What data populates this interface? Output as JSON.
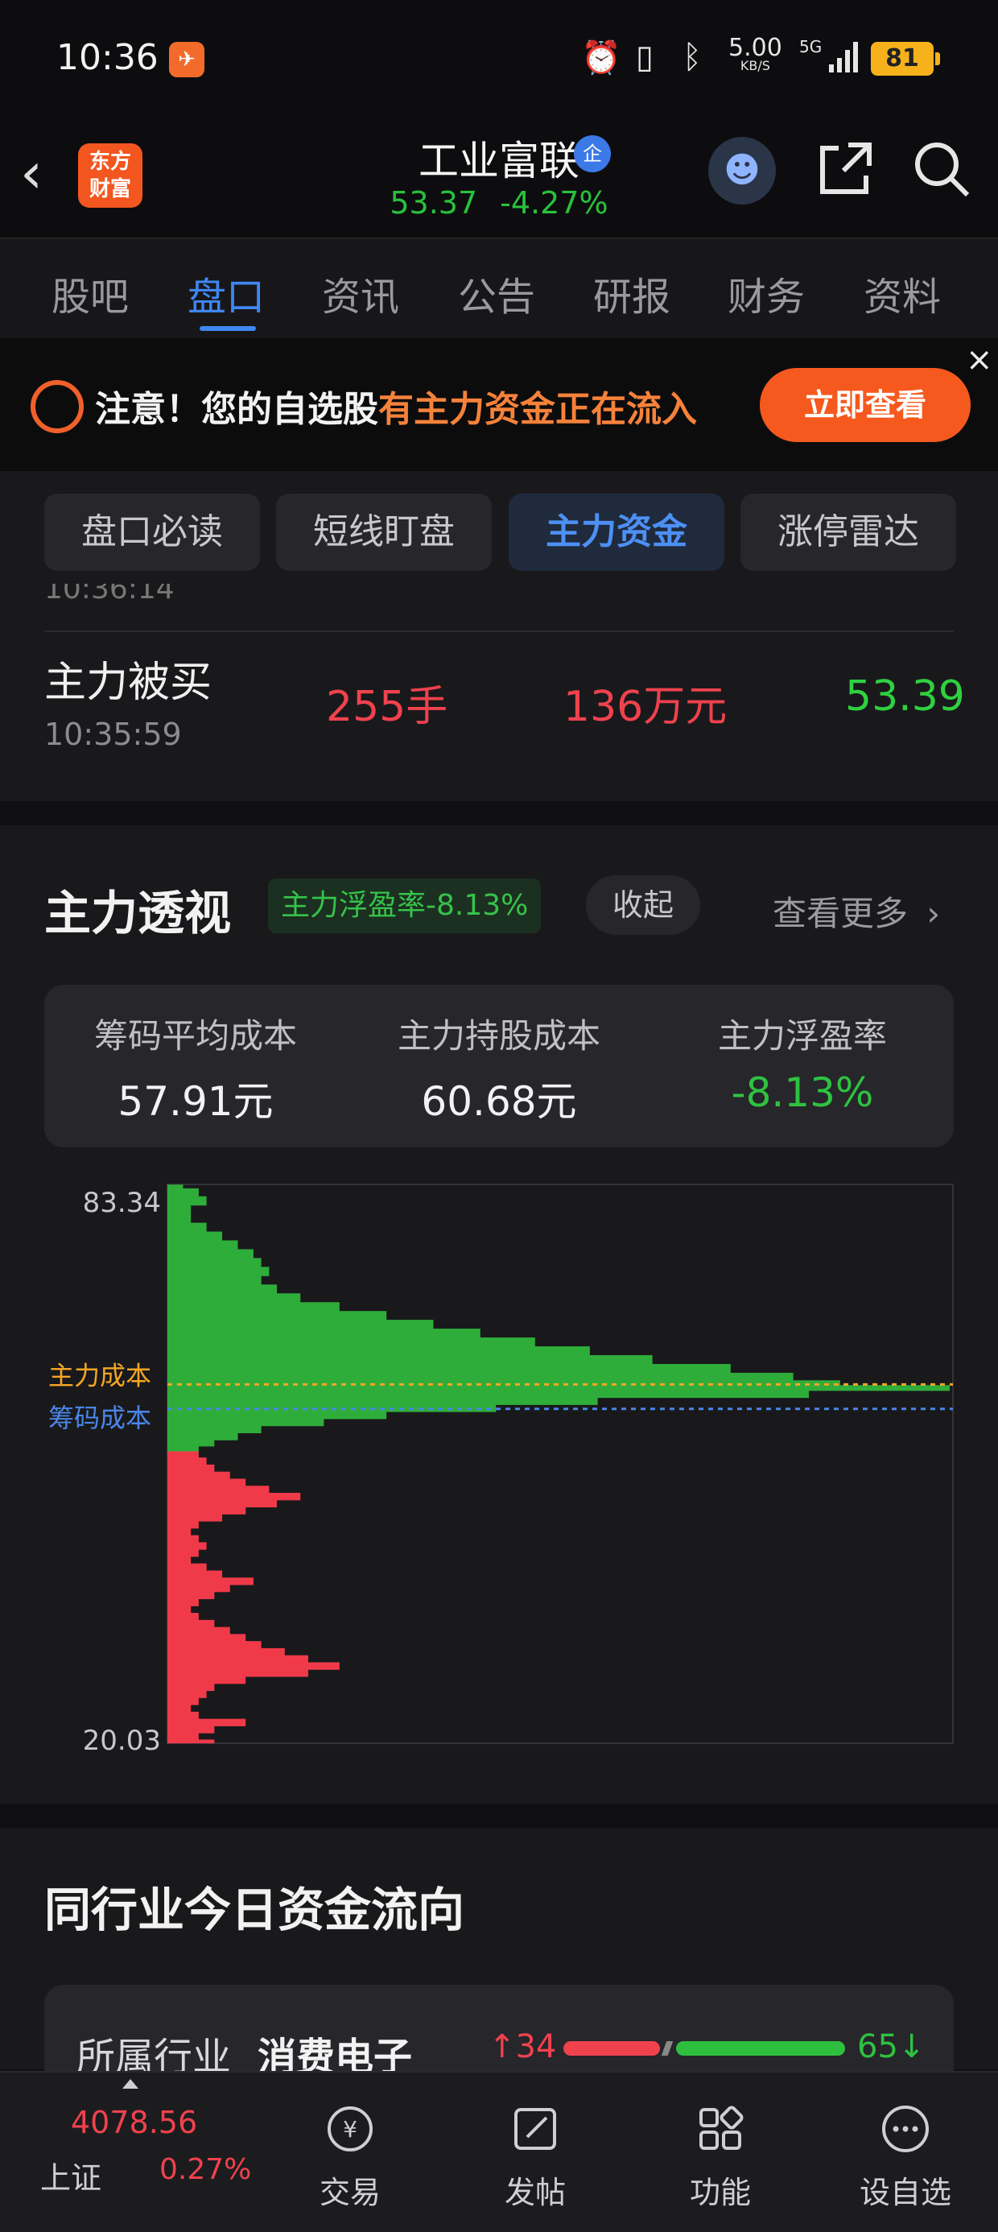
{
  "status_bar": {
    "time": "10:36",
    "net_speed": "5.00",
    "net_unit": "KB/S",
    "network": "5G",
    "battery": "81"
  },
  "header": {
    "logo_line1": "东方",
    "logo_line2": "财富",
    "stock_name": "工业富联",
    "verify_badge": "企",
    "price": "53.37",
    "change_pct": "-4.27%"
  },
  "tabs": [
    {
      "label": "股吧"
    },
    {
      "label": "盘口"
    },
    {
      "label": "资讯"
    },
    {
      "label": "公告"
    },
    {
      "label": "研报"
    },
    {
      "label": "财务"
    },
    {
      "label": "资料"
    }
  ],
  "active_tab": "盘口",
  "banner": {
    "text_prefix": "注意！您的自选股",
    "text_highlight": "有主力资金正在流入",
    "button": "立即查看",
    "close": "×"
  },
  "subtabs": [
    {
      "label": "盘口必读"
    },
    {
      "label": "短线盯盘"
    },
    {
      "label": "主力资金"
    },
    {
      "label": "涨停雷达"
    }
  ],
  "trades": {
    "prev_time": "10:36:14",
    "row": {
      "type": "主力被买",
      "time": "10:35:59",
      "volume": "255手",
      "amount": "136万元",
      "price": "53.39"
    }
  },
  "main_force": {
    "title": "主力透视",
    "badge": "主力浮盈率-8.13%",
    "collapse": "收起",
    "more": "查看更多",
    "stats": [
      {
        "label": "筹码平均成本",
        "value": "57.91元"
      },
      {
        "label": "主力持股成本",
        "value": "60.68元"
      },
      {
        "label": "主力浮盈率",
        "value": "-8.13%"
      }
    ]
  },
  "chart_data": {
    "type": "bar",
    "orientation": "horizontal",
    "description_of_marks": "chip distribution profile: green = price levels above current price, red = below",
    "ymax_label": "83.34",
    "ymin_label": "20.03",
    "ylim": [
      20.03,
      83.34
    ],
    "current_price": 53.37,
    "lines": [
      {
        "label": "主力成本",
        "value": 60.68,
        "color": "#f5a623"
      },
      {
        "label": "筹码成本",
        "value": 57.91,
        "color": "#4a86e8"
      }
    ],
    "colors": {
      "above": "#2fad3a",
      "below": "#f03a4a"
    },
    "profile": [
      [
        83.3,
        2
      ],
      [
        82.5,
        4
      ],
      [
        81.5,
        5
      ],
      [
        80.5,
        3
      ],
      [
        79.5,
        3
      ],
      [
        78.5,
        5
      ],
      [
        77.5,
        7
      ],
      [
        76.5,
        9
      ],
      [
        75.5,
        11
      ],
      [
        74.5,
        12
      ],
      [
        73.5,
        13
      ],
      [
        72.5,
        12
      ],
      [
        71.5,
        14
      ],
      [
        70.5,
        17
      ],
      [
        69.5,
        22
      ],
      [
        68.5,
        28
      ],
      [
        67.5,
        34
      ],
      [
        66.5,
        40
      ],
      [
        65.5,
        47
      ],
      [
        64.5,
        54
      ],
      [
        63.5,
        62
      ],
      [
        62.5,
        72
      ],
      [
        61.5,
        80
      ],
      [
        60.8,
        86
      ],
      [
        60.4,
        100
      ],
      [
        59.6,
        82
      ],
      [
        58.8,
        55
      ],
      [
        58.0,
        42
      ],
      [
        57.2,
        28
      ],
      [
        56.4,
        20
      ],
      [
        55.6,
        12
      ],
      [
        54.8,
        9
      ],
      [
        54.0,
        6
      ],
      [
        53.4,
        4
      ],
      [
        52.8,
        4
      ],
      [
        52.0,
        5
      ],
      [
        51.2,
        6
      ],
      [
        50.4,
        8
      ],
      [
        49.6,
        10
      ],
      [
        48.8,
        13
      ],
      [
        48.0,
        17
      ],
      [
        47.2,
        14
      ],
      [
        46.4,
        10
      ],
      [
        45.6,
        7
      ],
      [
        44.8,
        4
      ],
      [
        44.0,
        3
      ],
      [
        43.2,
        4
      ],
      [
        42.4,
        5
      ],
      [
        41.6,
        4
      ],
      [
        40.8,
        3
      ],
      [
        40.0,
        5
      ],
      [
        39.2,
        7
      ],
      [
        38.4,
        11
      ],
      [
        37.6,
        8
      ],
      [
        36.8,
        6
      ],
      [
        36.0,
        4
      ],
      [
        35.2,
        3
      ],
      [
        34.4,
        4
      ],
      [
        33.6,
        6
      ],
      [
        32.8,
        8
      ],
      [
        32.0,
        10
      ],
      [
        31.2,
        12
      ],
      [
        30.4,
        15
      ],
      [
        29.6,
        18
      ],
      [
        28.8,
        22
      ],
      [
        28.0,
        18
      ],
      [
        27.2,
        10
      ],
      [
        26.4,
        6
      ],
      [
        25.6,
        5
      ],
      [
        24.8,
        4
      ],
      [
        24.0,
        3
      ],
      [
        23.2,
        4
      ],
      [
        22.4,
        10
      ],
      [
        21.6,
        6
      ],
      [
        20.8,
        4
      ],
      [
        20.1,
        6
      ]
    ]
  },
  "industry": {
    "title": "同行业今日资金流向",
    "label": "所属行业",
    "name": "消费电子",
    "up_count": "34",
    "down_count": "65"
  },
  "bottom_nav": {
    "index_value": "4078.56",
    "index_name": "上证",
    "index_change": "0.27%",
    "items": [
      {
        "label": "交易"
      },
      {
        "label": "发帖"
      },
      {
        "label": "功能"
      },
      {
        "label": "设自选"
      }
    ]
  }
}
